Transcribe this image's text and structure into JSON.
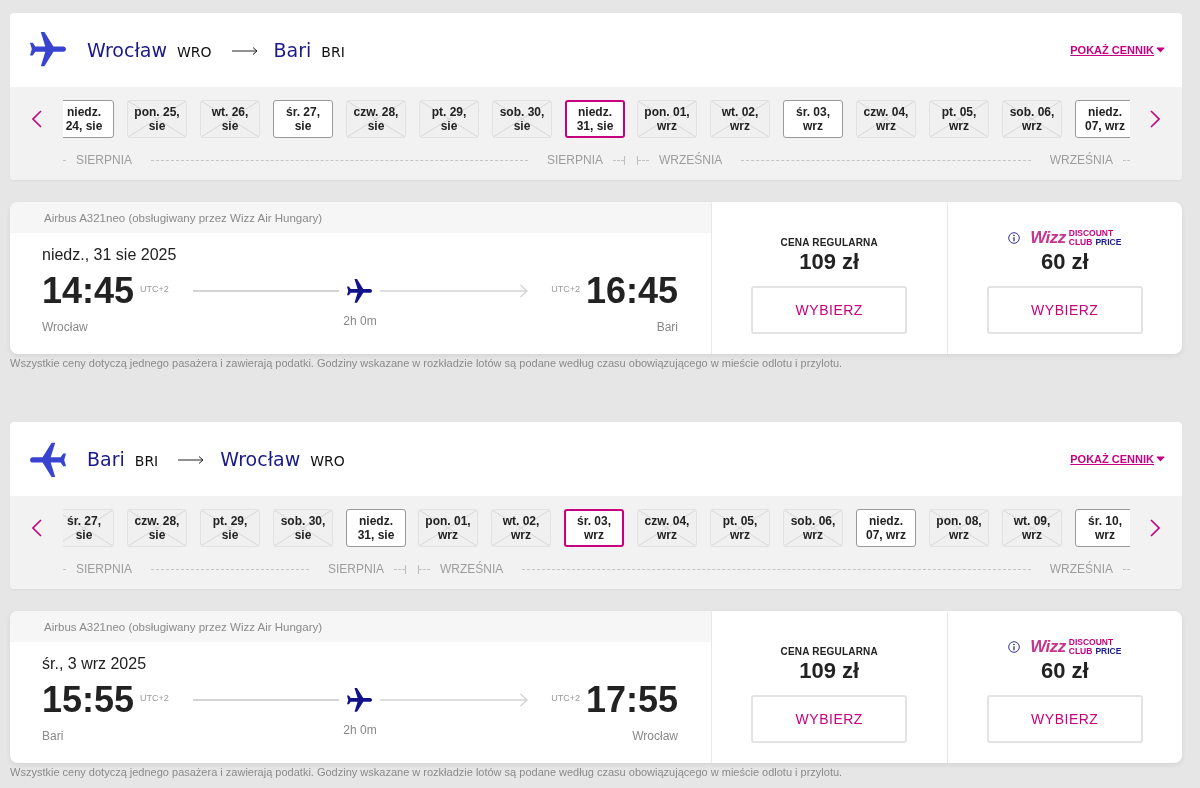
{
  "sections": [
    {
      "kind": "outbound",
      "route": {
        "origin_city": "Wrocław",
        "origin_code": "WRO",
        "destination_city": "Bari",
        "destination_code": "BRI"
      },
      "price_link": "POKAŻ CENNIK",
      "date_strip": {
        "month_groups": [
          {
            "start_label": "SIERPNIA",
            "end_label": "SIERPNIA",
            "days": [
              {
                "label": "niedz. 24, sie",
                "available": true,
                "selected": false
              },
              {
                "label": "pon. 25, sie",
                "available": false,
                "selected": false
              },
              {
                "label": "wt. 26, sie",
                "available": false,
                "selected": false
              },
              {
                "label": "śr. 27, sie",
                "available": true,
                "selected": false
              },
              {
                "label": "czw. 28, sie",
                "available": false,
                "selected": false
              },
              {
                "label": "pt. 29, sie",
                "available": false,
                "selected": false
              },
              {
                "label": "sob. 30, sie",
                "available": false,
                "selected": false
              },
              {
                "label": "niedz. 31, sie",
                "available": true,
                "selected": true
              }
            ]
          },
          {
            "start_label": "WRZEŚNIA",
            "end_label": "WRZEŚNIA",
            "days": [
              {
                "label": "pon. 01, wrz",
                "available": false,
                "selected": false
              },
              {
                "label": "wt. 02, wrz",
                "available": false,
                "selected": false
              },
              {
                "label": "śr. 03, wrz",
                "available": true,
                "selected": false
              },
              {
                "label": "czw. 04, wrz",
                "available": false,
                "selected": false
              },
              {
                "label": "pt. 05, wrz",
                "available": false,
                "selected": false
              },
              {
                "label": "sob. 06, wrz",
                "available": false,
                "selected": false
              },
              {
                "label": "niedz. 07, wrz",
                "available": true,
                "selected": false
              }
            ]
          }
        ]
      },
      "flight": {
        "aircraft": "Airbus A321neo (obsługiwany przez Wizz Air Hungary)",
        "date": "niedz., 31 sie 2025",
        "departure_time": "14:45",
        "departure_tz": "UTC+2",
        "departure_city": "Wrocław",
        "duration": "2h 0m",
        "arrival_tz": "UTC+2",
        "arrival_time": "16:45",
        "arrival_city": "Bari",
        "fares": [
          {
            "kind": "regular",
            "label": "CENA REGULARNA",
            "price": "109 zł",
            "button": "WYBIERZ"
          },
          {
            "kind": "club",
            "logo": {
              "wordmark": "Wizz",
              "tagline": [
                "DISCOUNT",
                "CLUB",
                "PRICE"
              ]
            },
            "price": "60 zł",
            "button": "WYBIERZ"
          }
        ]
      },
      "disclaimer": "Wszystkie ceny dotyczą jednego pasażera i zawierają podatki. Godziny wskazane w rozkładzie lotów są podane według czasu obowiązującego w mieście odlotu i przylotu."
    },
    {
      "kind": "return",
      "route": {
        "origin_city": "Bari",
        "origin_code": "BRI",
        "destination_city": "Wrocław",
        "destination_code": "WRO"
      },
      "price_link": "POKAŻ CENNIK",
      "date_strip": {
        "month_groups": [
          {
            "start_label": "SIERPNIA",
            "end_label": "SIERPNIA",
            "days": [
              {
                "label": "śr. 27, sie",
                "available": false,
                "selected": false
              },
              {
                "label": "czw. 28, sie",
                "available": false,
                "selected": false
              },
              {
                "label": "pt. 29, sie",
                "available": false,
                "selected": false
              },
              {
                "label": "sob. 30, sie",
                "available": false,
                "selected": false
              },
              {
                "label": "niedz. 31, sie",
                "available": true,
                "selected": false
              }
            ]
          },
          {
            "start_label": "WRZEŚNIA",
            "end_label": "WRZEŚNIA",
            "days": [
              {
                "label": "pon. 01, wrz",
                "available": false,
                "selected": false
              },
              {
                "label": "wt. 02, wrz",
                "available": false,
                "selected": false
              },
              {
                "label": "śr. 03, wrz",
                "available": true,
                "selected": true
              },
              {
                "label": "czw. 04, wrz",
                "available": false,
                "selected": false
              },
              {
                "label": "pt. 05, wrz",
                "available": false,
                "selected": false
              },
              {
                "label": "sob. 06, wrz",
                "available": false,
                "selected": false
              },
              {
                "label": "niedz. 07, wrz",
                "available": true,
                "selected": false
              },
              {
                "label": "pon. 08, wrz",
                "available": false,
                "selected": false
              },
              {
                "label": "wt. 09, wrz",
                "available": false,
                "selected": false
              },
              {
                "label": "śr. 10, wrz",
                "available": true,
                "selected": false
              }
            ]
          }
        ]
      },
      "flight": {
        "aircraft": "Airbus A321neo (obsługiwany przez Wizz Air Hungary)",
        "date": "śr., 3 wrz 2025",
        "departure_time": "15:55",
        "departure_tz": "UTC+2",
        "departure_city": "Bari",
        "duration": "2h 0m",
        "arrival_tz": "UTC+2",
        "arrival_time": "17:55",
        "arrival_city": "Wrocław",
        "fares": [
          {
            "kind": "regular",
            "label": "CENA REGULARNA",
            "price": "109 zł",
            "button": "WYBIERZ"
          },
          {
            "kind": "club",
            "logo": {
              "wordmark": "Wizz",
              "tagline": [
                "DISCOUNT",
                "CLUB",
                "PRICE"
              ]
            },
            "price": "60 zł",
            "button": "WYBIERZ"
          }
        ]
      },
      "disclaimer": "Wszystkie ceny dotyczą jednego pasażera i zawierają podatki. Godziny wskazane w rozkładzie lotów są podane według czasu obowiązującego w mieście odlotu i przylotu."
    }
  ]
}
